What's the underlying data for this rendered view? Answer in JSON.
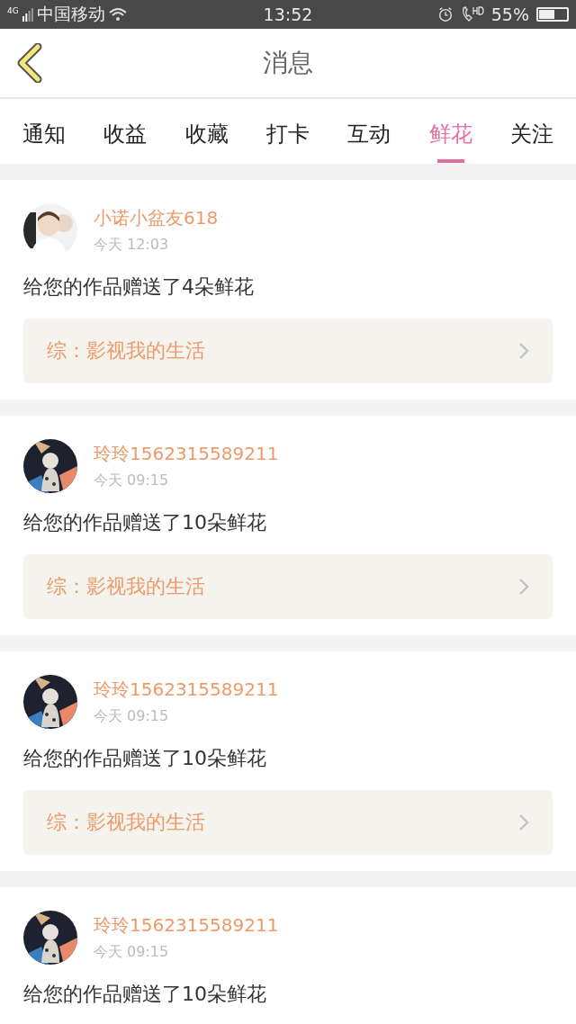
{
  "status_bar": {
    "carrier": "中国移动",
    "network": "4G",
    "time": "13:52",
    "battery_text": "55%"
  },
  "header": {
    "title": "消息"
  },
  "tabs": [
    {
      "label": "通知",
      "selected": false
    },
    {
      "label": "收益",
      "selected": false
    },
    {
      "label": "收藏",
      "selected": false
    },
    {
      "label": "打卡",
      "selected": false
    },
    {
      "label": "互动",
      "selected": false
    },
    {
      "label": "鲜花",
      "selected": true
    },
    {
      "label": "关注",
      "selected": false
    }
  ],
  "messages": [
    {
      "user": "小诺小盆友618",
      "time": "今天 12:03",
      "text": "给您的作品赠送了4朵鲜花",
      "work": "综：影视我的生活"
    },
    {
      "user": "玲玲1562315589211",
      "time": "今天 09:15",
      "text": "给您的作品赠送了10朵鲜花",
      "work": "综：影视我的生活"
    },
    {
      "user": "玲玲1562315589211",
      "time": "今天 09:15",
      "text": "给您的作品赠送了10朵鲜花",
      "work": "综：影视我的生活"
    },
    {
      "user": "玲玲1562315589211",
      "time": "今天 09:15",
      "text": "给您的作品赠送了10朵鲜花"
    }
  ]
}
